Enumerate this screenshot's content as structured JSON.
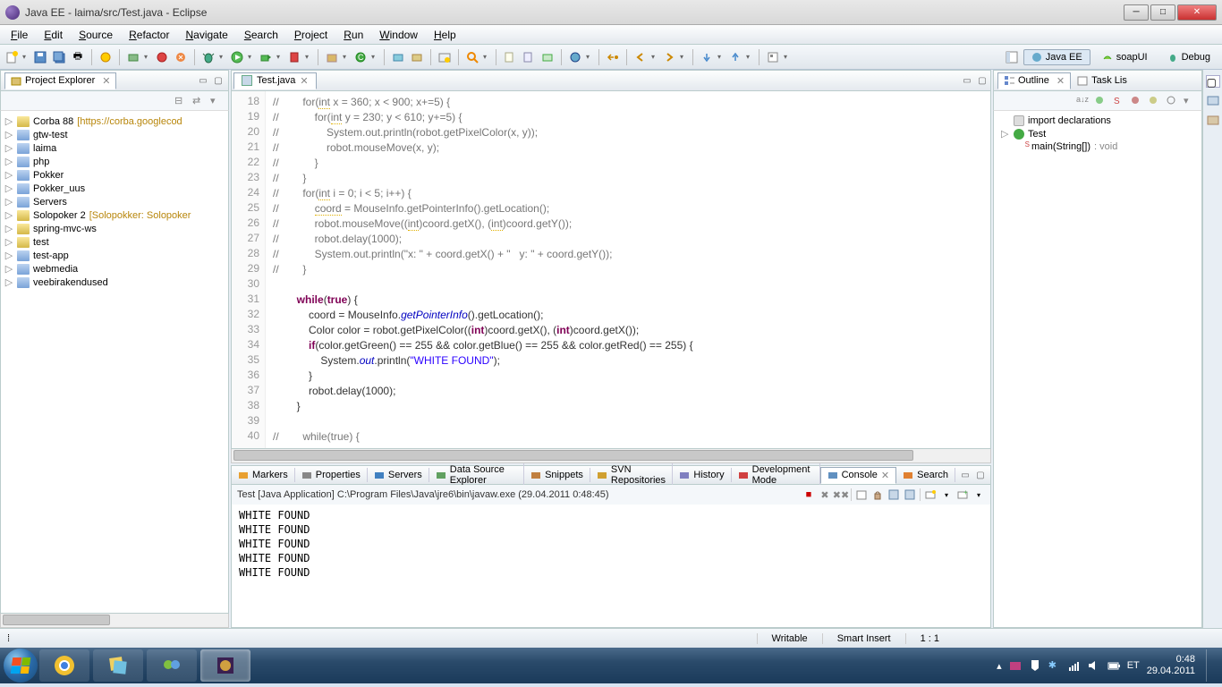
{
  "window": {
    "title": "Java EE - laima/src/Test.java - Eclipse"
  },
  "menus": [
    "File",
    "Edit",
    "Source",
    "Refactor",
    "Navigate",
    "Search",
    "Project",
    "Run",
    "Window",
    "Help"
  ],
  "perspectives": {
    "open_label": "",
    "items": [
      "Java EE",
      "soapUI",
      "Debug"
    ],
    "active": "Java EE"
  },
  "project_explorer": {
    "title": "Project Explorer",
    "items": [
      {
        "label": "Corba 88",
        "anno": "[https://corba.googlecod",
        "icon": "folder-y",
        "expandable": true
      },
      {
        "label": "gtw-test",
        "icon": "folder-b",
        "expandable": true
      },
      {
        "label": "laima",
        "icon": "folder-b",
        "expandable": true
      },
      {
        "label": "php",
        "icon": "folder-b",
        "expandable": true
      },
      {
        "label": "Pokker",
        "icon": "folder-b",
        "expandable": true
      },
      {
        "label": "Pokker_uus",
        "icon": "folder-b",
        "expandable": true
      },
      {
        "label": "Servers",
        "icon": "folder-b",
        "expandable": true
      },
      {
        "label": "Solopoker 2",
        "anno": "[Solopokker: Solopoker",
        "icon": "folder-y",
        "expandable": true
      },
      {
        "label": "spring-mvc-ws",
        "icon": "folder-y",
        "expandable": true
      },
      {
        "label": "test",
        "icon": "folder-y",
        "expandable": true
      },
      {
        "label": "test-app",
        "icon": "folder-b",
        "expandable": true
      },
      {
        "label": "webmedia",
        "icon": "folder-b",
        "expandable": true
      },
      {
        "label": "veebirakendused",
        "icon": "folder-b",
        "expandable": true
      }
    ]
  },
  "editor": {
    "tab": "Test.java",
    "first_line_no": 18,
    "lines": [
      {
        "n": 18,
        "html": "<span class='cm'>//        for(<span class='sq'>int</span> x = 360; x &lt; 900; x+=5) {</span>"
      },
      {
        "n": 19,
        "html": "<span class='cm'>//            for(<span class='sq'>int</span> y = 230; y &lt; 610; y+=5) {</span>"
      },
      {
        "n": 20,
        "html": "<span class='cm'>//                System.out.println(robot.getPixelColor(x, y));</span>"
      },
      {
        "n": 21,
        "html": "<span class='cm'>//                robot.mouseMove(x, y);</span>"
      },
      {
        "n": 22,
        "html": "<span class='cm'>//            }</span>"
      },
      {
        "n": 23,
        "html": "<span class='cm'>//        }</span>"
      },
      {
        "n": 24,
        "html": "<span class='cm'>//        for(<span class='sq'>int</span> i = 0; i &lt; 5; i++) {</span>"
      },
      {
        "n": 25,
        "html": "<span class='cm'>//            <span class='sq'>coord</span> = MouseInfo.getPointerInfo().getLocation();</span>"
      },
      {
        "n": 26,
        "html": "<span class='cm'>//            robot.mouseMove((<span class='sq'>int</span>)coord.getX(), (<span class='sq'>int</span>)coord.getY());</span>"
      },
      {
        "n": 27,
        "html": "<span class='cm'>//            robot.delay(1000);</span>"
      },
      {
        "n": 28,
        "html": "<span class='cm'>//            System.out.println(\"x: \" + coord.getX() + \"   y: \" + coord.getY());</span>"
      },
      {
        "n": 29,
        "html": "<span class='cm'>//        }</span>"
      },
      {
        "n": 30,
        "html": ""
      },
      {
        "n": 31,
        "html": "        <span class='kw'>while</span>(<span class='kw'>true</span>) {"
      },
      {
        "n": 32,
        "html": "            coord = MouseInfo.<span class='it'>getPointerInfo</span>().getLocation();"
      },
      {
        "n": 33,
        "html": "            Color color = robot.getPixelColor((<span class='kw'>int</span>)coord.getX(), (<span class='kw'>int</span>)coord.getX());"
      },
      {
        "n": 34,
        "html": "            <span class='kw'>if</span>(color.getGreen() == 255 &amp;&amp; color.getBlue() == 255 &amp;&amp; color.getRed() == 255) {"
      },
      {
        "n": 35,
        "html": "                System.<span class='it'>out</span>.println(<span class='st'>\"WHITE FOUND\"</span>);"
      },
      {
        "n": 36,
        "html": "            }"
      },
      {
        "n": 37,
        "html": "            robot.delay(1000);"
      },
      {
        "n": 38,
        "html": "        }"
      },
      {
        "n": 39,
        "html": ""
      },
      {
        "n": 40,
        "html": "<span class='cm'>//        while(true) {</span>"
      }
    ]
  },
  "bottom_tabs": [
    "Markers",
    "Properties",
    "Servers",
    "Data Source Explorer",
    "Snippets",
    "SVN Repositories",
    "History",
    "Development Mode",
    "Console",
    "Search"
  ],
  "bottom_active": "Console",
  "console": {
    "desc": "Test [Java Application] C:\\Program Files\\Java\\jre6\\bin\\javaw.exe (29.04.2011 0:48:45)",
    "output": [
      "WHITE FOUND",
      "WHITE FOUND",
      "WHITE FOUND",
      "WHITE FOUND",
      "WHITE FOUND"
    ]
  },
  "outline": {
    "tabs": [
      "Outline",
      "Task Lis"
    ],
    "items": [
      {
        "label": "import declarations",
        "icon": "pkg",
        "indent": 0
      },
      {
        "label": "Test",
        "icon": "green",
        "indent": 0
      },
      {
        "label": "main(String[])",
        "ret": ": void",
        "icon": "green",
        "indent": 1,
        "static": true
      }
    ]
  },
  "statusbar": {
    "mode": "Writable",
    "insert": "Smart Insert",
    "pos": "1 : 1"
  },
  "taskbar": {
    "time": "0:48",
    "date": "29.04.2011",
    "lang": "ET"
  }
}
